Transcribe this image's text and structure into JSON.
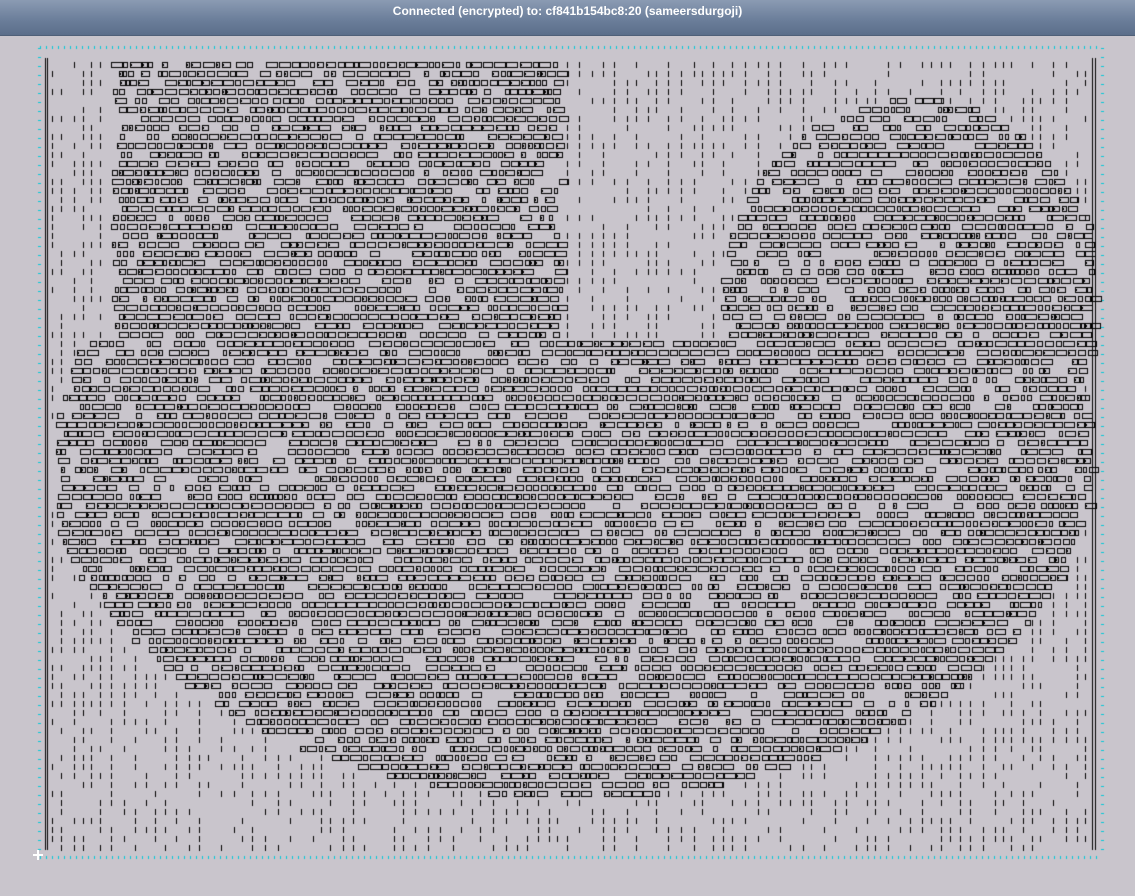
{
  "window": {
    "title": "Connected (encrypted) to: cf841b154bc8:20 (sameersdurgoji)"
  },
  "layout_view": {
    "description_colors": {
      "background": "#c9c5cc",
      "cells": "#000000",
      "grid_markers": "#00c8d8",
      "origin_marker": "#ffffff"
    },
    "origin_icon": "crosshair-icon"
  }
}
